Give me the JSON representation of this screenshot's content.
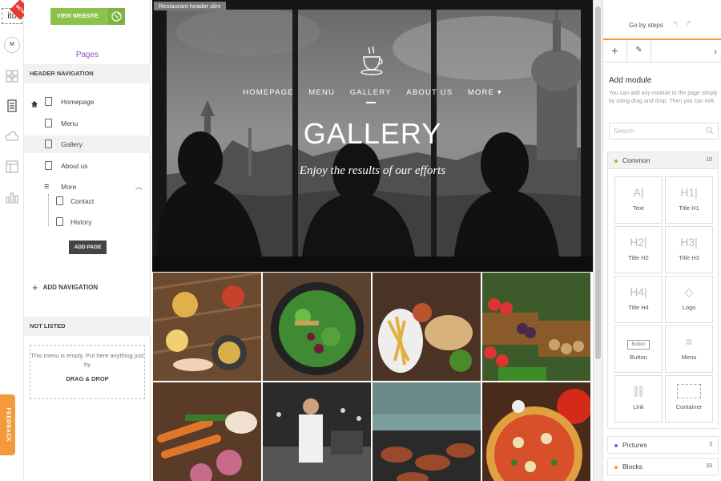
{
  "rail": {
    "logo": "ito",
    "beta": "BETA",
    "avatar": "M",
    "feedback": "FEEDBACK",
    "icons": [
      "grid-icon",
      "pages-icon",
      "cloud-icon",
      "layout-icon",
      "stats-icon"
    ]
  },
  "left": {
    "view_website": "VIEW WEBSITE",
    "title": "Pages",
    "header_nav": "HEADER NAVIGATION",
    "pages": [
      "Homepage",
      "Menu",
      "Gallery",
      "About us",
      "More",
      "Contact",
      "History"
    ],
    "add_page": "ADD PAGE",
    "add_nav": "ADD NAVIGATION",
    "not_listed": "NOT LISTED",
    "empty_text": "This menu is empty. Put here anything just by",
    "drag_drop": "DRAG & DROP"
  },
  "canvas": {
    "module_tag": "Restaurant header slim",
    "nav": [
      "HOMEPAGE",
      "MENU",
      "GALLERY",
      "ABOUT US",
      "MORE ▾"
    ],
    "title": "GALLERY",
    "subtitle": "Enjoy the results of our efforts"
  },
  "right": {
    "steps": "Go by steps",
    "add_module": "Add module",
    "desc": "You can add any module to the page simply by using drag and drop. Then you can edit.",
    "search_placeholder": "Search",
    "categories": [
      {
        "name": "Common",
        "count": "10",
        "color": "#8bc34a"
      },
      {
        "name": "Pictures",
        "count": "3",
        "color": "#8e57c7"
      },
      {
        "name": "Blocks",
        "count": "33",
        "color": "#f39a3a"
      }
    ],
    "modules": [
      "Text",
      "Title H1",
      "Title H2",
      "Title H3",
      "Title H4",
      "Logo",
      "Button",
      "Menu",
      "Link",
      "Container"
    ],
    "module_glyphs": [
      "A|",
      "H1|",
      "H2|",
      "H3|",
      "H4|",
      "◇",
      "Button",
      "≡",
      "⛓",
      ""
    ]
  },
  "colors": {
    "accent": "#f39a3a",
    "green": "#8bc34a",
    "purple": "#8e57c7"
  }
}
